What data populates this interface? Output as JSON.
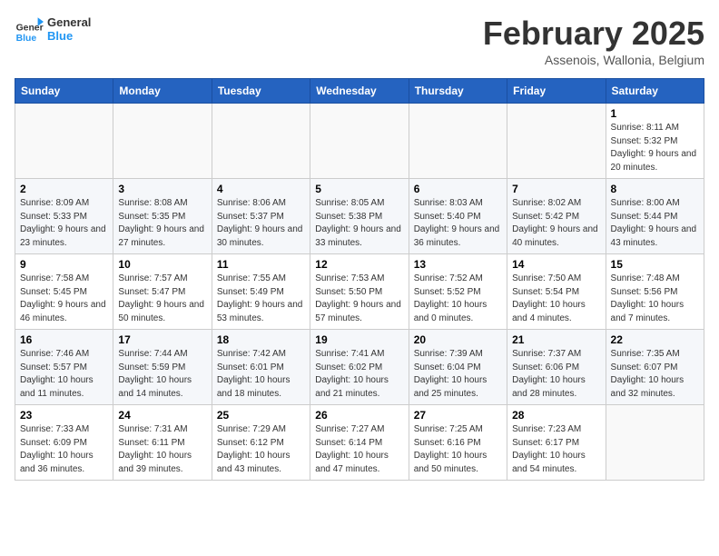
{
  "logo": {
    "general": "General",
    "blue": "Blue"
  },
  "header": {
    "month": "February 2025",
    "location": "Assenois, Wallonia, Belgium"
  },
  "weekdays": [
    "Sunday",
    "Monday",
    "Tuesday",
    "Wednesday",
    "Thursday",
    "Friday",
    "Saturday"
  ],
  "weeks": [
    [
      {
        "day": "",
        "info": ""
      },
      {
        "day": "",
        "info": ""
      },
      {
        "day": "",
        "info": ""
      },
      {
        "day": "",
        "info": ""
      },
      {
        "day": "",
        "info": ""
      },
      {
        "day": "",
        "info": ""
      },
      {
        "day": "1",
        "info": "Sunrise: 8:11 AM\nSunset: 5:32 PM\nDaylight: 9 hours and 20 minutes."
      }
    ],
    [
      {
        "day": "2",
        "info": "Sunrise: 8:09 AM\nSunset: 5:33 PM\nDaylight: 9 hours and 23 minutes."
      },
      {
        "day": "3",
        "info": "Sunrise: 8:08 AM\nSunset: 5:35 PM\nDaylight: 9 hours and 27 minutes."
      },
      {
        "day": "4",
        "info": "Sunrise: 8:06 AM\nSunset: 5:37 PM\nDaylight: 9 hours and 30 minutes."
      },
      {
        "day": "5",
        "info": "Sunrise: 8:05 AM\nSunset: 5:38 PM\nDaylight: 9 hours and 33 minutes."
      },
      {
        "day": "6",
        "info": "Sunrise: 8:03 AM\nSunset: 5:40 PM\nDaylight: 9 hours and 36 minutes."
      },
      {
        "day": "7",
        "info": "Sunrise: 8:02 AM\nSunset: 5:42 PM\nDaylight: 9 hours and 40 minutes."
      },
      {
        "day": "8",
        "info": "Sunrise: 8:00 AM\nSunset: 5:44 PM\nDaylight: 9 hours and 43 minutes."
      }
    ],
    [
      {
        "day": "9",
        "info": "Sunrise: 7:58 AM\nSunset: 5:45 PM\nDaylight: 9 hours and 46 minutes."
      },
      {
        "day": "10",
        "info": "Sunrise: 7:57 AM\nSunset: 5:47 PM\nDaylight: 9 hours and 50 minutes."
      },
      {
        "day": "11",
        "info": "Sunrise: 7:55 AM\nSunset: 5:49 PM\nDaylight: 9 hours and 53 minutes."
      },
      {
        "day": "12",
        "info": "Sunrise: 7:53 AM\nSunset: 5:50 PM\nDaylight: 9 hours and 57 minutes."
      },
      {
        "day": "13",
        "info": "Sunrise: 7:52 AM\nSunset: 5:52 PM\nDaylight: 10 hours and 0 minutes."
      },
      {
        "day": "14",
        "info": "Sunrise: 7:50 AM\nSunset: 5:54 PM\nDaylight: 10 hours and 4 minutes."
      },
      {
        "day": "15",
        "info": "Sunrise: 7:48 AM\nSunset: 5:56 PM\nDaylight: 10 hours and 7 minutes."
      }
    ],
    [
      {
        "day": "16",
        "info": "Sunrise: 7:46 AM\nSunset: 5:57 PM\nDaylight: 10 hours and 11 minutes."
      },
      {
        "day": "17",
        "info": "Sunrise: 7:44 AM\nSunset: 5:59 PM\nDaylight: 10 hours and 14 minutes."
      },
      {
        "day": "18",
        "info": "Sunrise: 7:42 AM\nSunset: 6:01 PM\nDaylight: 10 hours and 18 minutes."
      },
      {
        "day": "19",
        "info": "Sunrise: 7:41 AM\nSunset: 6:02 PM\nDaylight: 10 hours and 21 minutes."
      },
      {
        "day": "20",
        "info": "Sunrise: 7:39 AM\nSunset: 6:04 PM\nDaylight: 10 hours and 25 minutes."
      },
      {
        "day": "21",
        "info": "Sunrise: 7:37 AM\nSunset: 6:06 PM\nDaylight: 10 hours and 28 minutes."
      },
      {
        "day": "22",
        "info": "Sunrise: 7:35 AM\nSunset: 6:07 PM\nDaylight: 10 hours and 32 minutes."
      }
    ],
    [
      {
        "day": "23",
        "info": "Sunrise: 7:33 AM\nSunset: 6:09 PM\nDaylight: 10 hours and 36 minutes."
      },
      {
        "day": "24",
        "info": "Sunrise: 7:31 AM\nSunset: 6:11 PM\nDaylight: 10 hours and 39 minutes."
      },
      {
        "day": "25",
        "info": "Sunrise: 7:29 AM\nSunset: 6:12 PM\nDaylight: 10 hours and 43 minutes."
      },
      {
        "day": "26",
        "info": "Sunrise: 7:27 AM\nSunset: 6:14 PM\nDaylight: 10 hours and 47 minutes."
      },
      {
        "day": "27",
        "info": "Sunrise: 7:25 AM\nSunset: 6:16 PM\nDaylight: 10 hours and 50 minutes."
      },
      {
        "day": "28",
        "info": "Sunrise: 7:23 AM\nSunset: 6:17 PM\nDaylight: 10 hours and 54 minutes."
      },
      {
        "day": "",
        "info": ""
      }
    ]
  ]
}
